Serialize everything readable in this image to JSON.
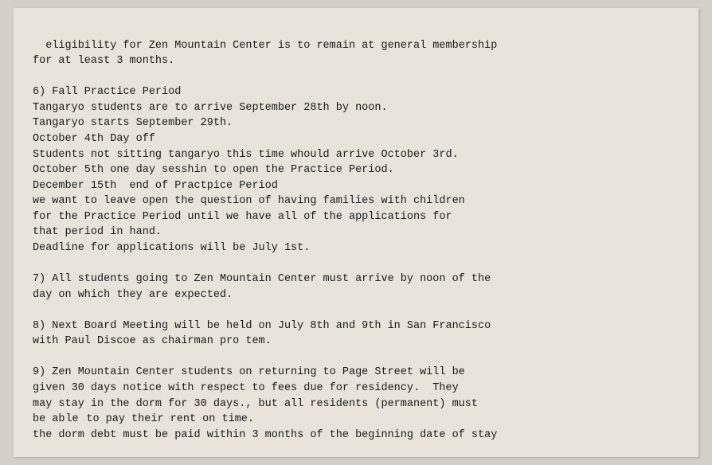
{
  "document": {
    "content": [
      {
        "id": "line-eligibility",
        "text": "eligibility for Zen Mountain Center is to remain at general membership\nfor at least 3 months."
      },
      {
        "id": "blank-1",
        "text": ""
      },
      {
        "id": "section-6",
        "text": "6) Fall Practice Period\nTangaryo students are to arrive September 28th by noon.\nTangaryo starts September 29th.\nOctober 4th Day off\nStudents not sitting tangaryo this time whould arrive October 3rd.\nOctober 5th one day sesshin to open the Practice Period.\nDecember 15th  end of Practpice Period\nwe want to leave open the question of having families with children\nfor the Practice Period until we have all of the applications for\nthat period in hand.\nDeadline for applications will be July 1st."
      },
      {
        "id": "blank-2",
        "text": ""
      },
      {
        "id": "section-7",
        "text": "7) All students going to Zen Mountain Center must arrive by noon of the\nday on which they are expected."
      },
      {
        "id": "blank-3",
        "text": ""
      },
      {
        "id": "section-8",
        "text": "8) Next Board Meeting will be held on July 8th and 9th in San Francisco\nwith Paul Discoe as chairman pro tem."
      },
      {
        "id": "blank-4",
        "text": ""
      },
      {
        "id": "section-9",
        "text": "9) Zen Mountain Center students on returning to Page Street will be\ngiven 30 days notice with respect to fees due for residency.  They\nmay stay in the dorm for 30 days., but all residents (permanent) must\nbe able &#x202F;to pay their rent on time.\nthe dorm debt must be paid within 3 months of the beginning date of stay"
      }
    ]
  }
}
